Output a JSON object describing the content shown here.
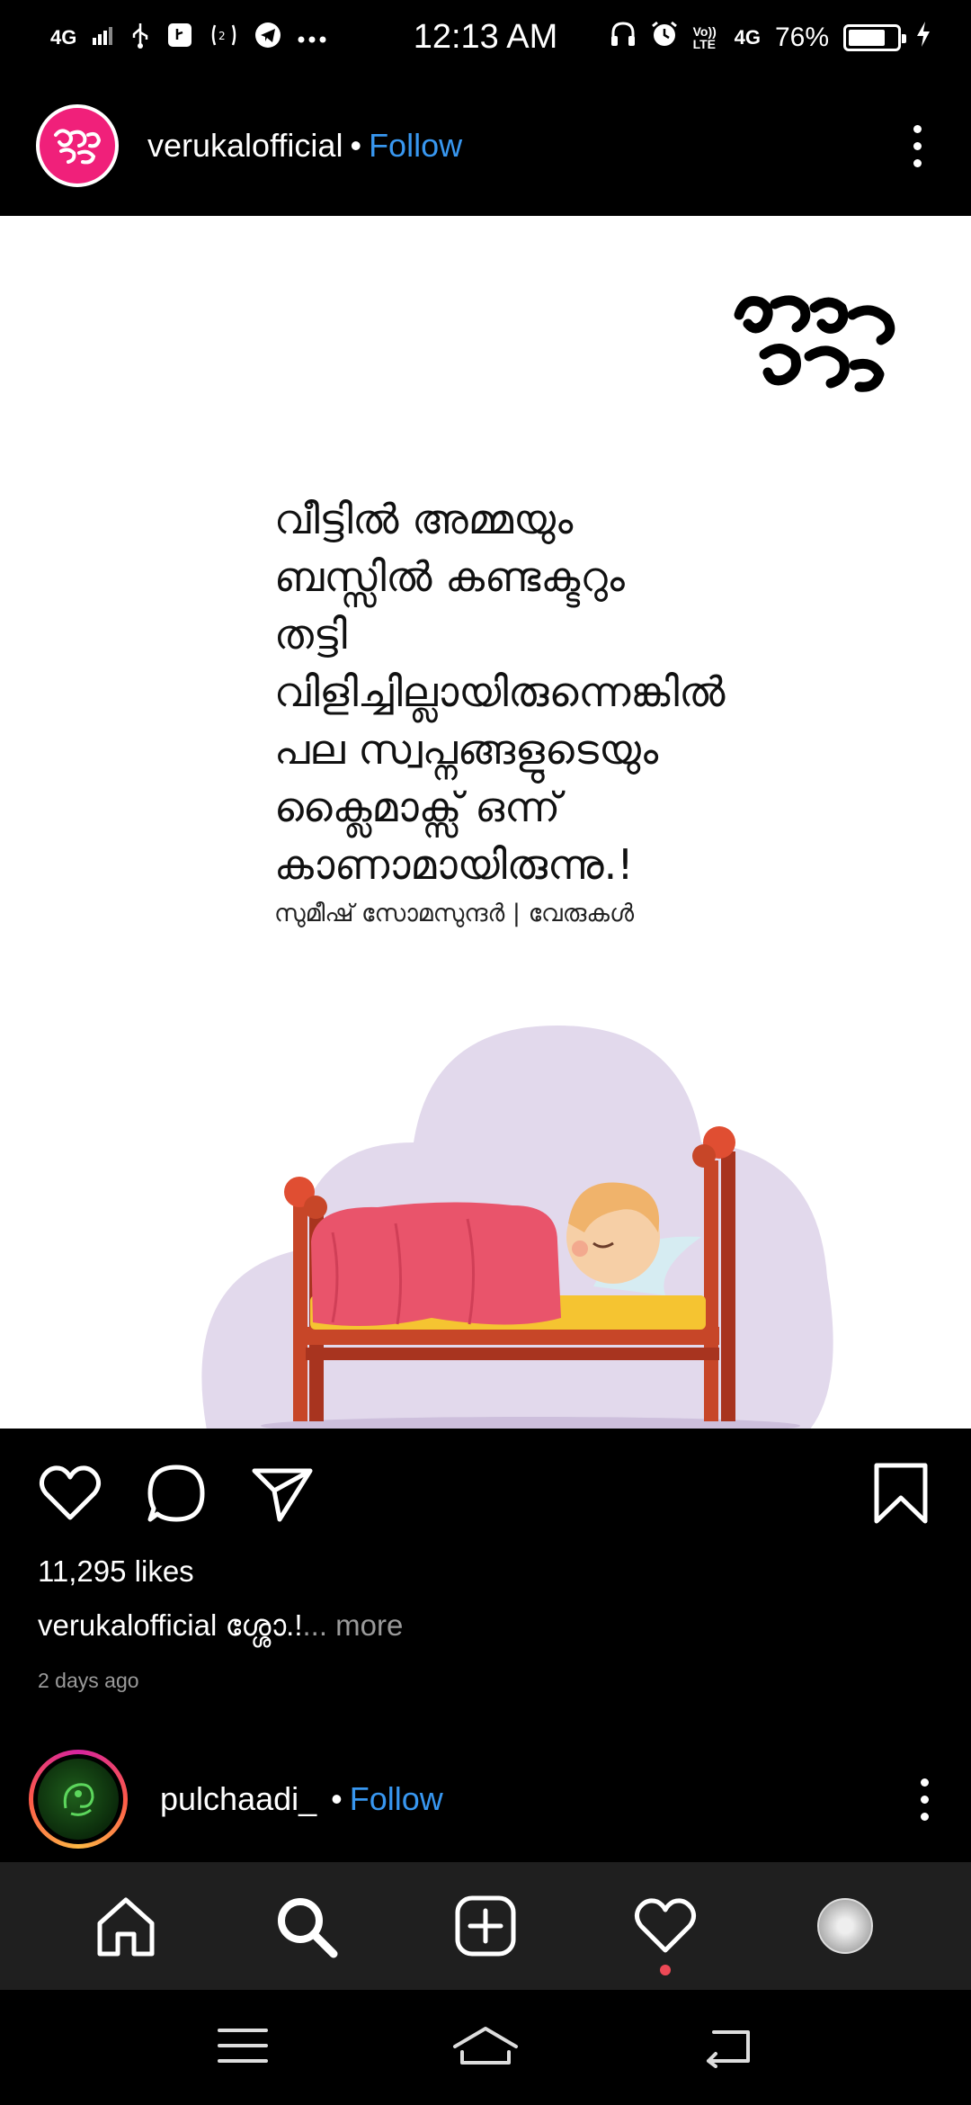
{
  "status_bar": {
    "time": "12:13 AM",
    "network_left": "4G",
    "battery_percent": "76%",
    "battery_level": 0.76,
    "volte": "Vo)) LTE",
    "network_right": "4G"
  },
  "post": {
    "username": "verukalofficial",
    "separator": "•",
    "follow_label": "Follow",
    "quote_lines": [
      "വീട്ടിൽ അമ്മയും",
      "ബസ്സിൽ കണ്ടക്ടറും",
      "തട്ടി",
      "വിളിച്ചില്ലായിരുന്നെങ്കിൽ",
      "പല സ്വപ്നങ്ങളുടെയും",
      "ക്ലൈമാക്സ് ഒന്ന്",
      "കാണാമായിരുന്നു.!"
    ],
    "author": "സുമീഷ് സോമസുന്ദർ | വേരുകൾ",
    "brand_logo_text": "വേരുകൾ",
    "likes": "11,295 likes",
    "caption_username": "verukalofficial",
    "caption_text": "ശ്ശോ.!",
    "caption_more": "... more",
    "time_ago": "2 days ago"
  },
  "next_post": {
    "username": "pulchaadi_",
    "separator": "•",
    "follow_label": "Follow"
  },
  "colors": {
    "follow_blue": "#3897f0",
    "brand_pink": "#f0207a",
    "notification_red": "#ed4956"
  },
  "icons": {
    "actions": [
      "heart-icon",
      "comment-icon",
      "share-icon",
      "bookmark-icon"
    ],
    "bottom_nav": [
      "home-icon",
      "search-icon",
      "add-post-icon",
      "activity-heart-icon",
      "profile-avatar"
    ],
    "system_nav": [
      "menu-icon",
      "home-outline-icon",
      "back-icon"
    ]
  }
}
